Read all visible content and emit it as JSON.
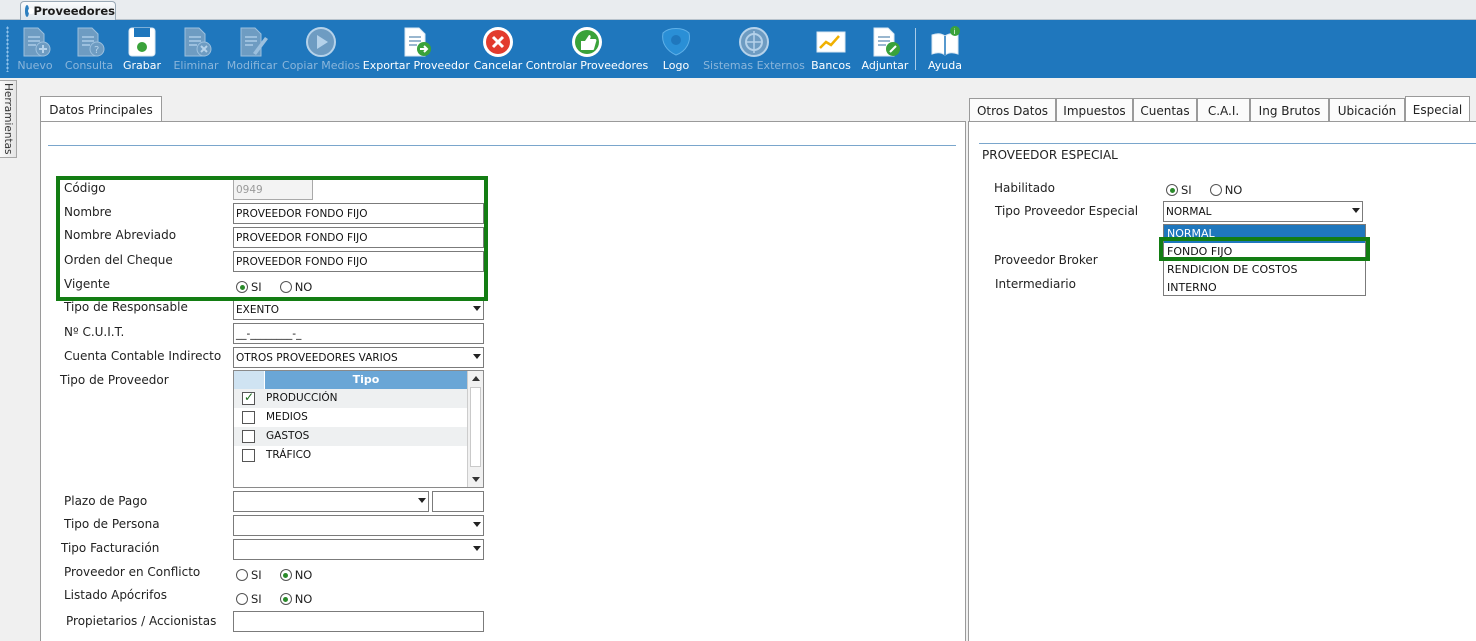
{
  "window": {
    "tab_title": "Proveedores"
  },
  "toolbar": {
    "buttons": [
      {
        "label": "Nuevo",
        "icon": "new-document-icon",
        "enabled": false
      },
      {
        "label": "Consulta",
        "icon": "query-document-icon",
        "enabled": false
      },
      {
        "label": "Grabar",
        "icon": "save-disk-icon",
        "enabled": true
      },
      {
        "label": "Eliminar",
        "icon": "delete-document-icon",
        "enabled": false
      },
      {
        "label": "Modificar",
        "icon": "edit-document-icon",
        "enabled": false
      },
      {
        "label": "Copiar Medios",
        "icon": "play-circle-icon",
        "enabled": false
      },
      {
        "label": "Exportar Proveedor",
        "icon": "export-document-icon",
        "enabled": true
      },
      {
        "label": "Cancelar",
        "icon": "cancel-icon",
        "enabled": true
      },
      {
        "label": "Controlar Proveedores",
        "icon": "thumbs-up-icon",
        "enabled": true
      },
      {
        "label": "Logo",
        "icon": "logo-icon",
        "enabled": true
      },
      {
        "label": "Sistemas Externos",
        "icon": "external-systems-icon",
        "enabled": false
      },
      {
        "label": "Bancos",
        "icon": "chart-icon",
        "enabled": true
      },
      {
        "label": "Adjuntar",
        "icon": "attach-document-icon",
        "enabled": true
      },
      {
        "label": "Ayuda",
        "icon": "help-book-icon",
        "enabled": true
      }
    ]
  },
  "side_tab": {
    "label": "Herramientas"
  },
  "left_panel": {
    "tab": "Datos Principales",
    "fields": {
      "codigo": {
        "label": "Código",
        "value": "0949"
      },
      "nombre": {
        "label": "Nombre",
        "value": "PROVEEDOR FONDO FIJO"
      },
      "nombre_abreviado": {
        "label": "Nombre Abreviado",
        "value": "PROVEEDOR FONDO FIJO"
      },
      "orden_cheque": {
        "label": "Orden del Cheque",
        "value": "PROVEEDOR FONDO FIJO"
      },
      "vigente": {
        "label": "Vigente",
        "yes": "SI",
        "no": "NO",
        "selected": "SI"
      },
      "tipo_responsable": {
        "label": "Tipo de Responsable",
        "value": "EXENTO"
      },
      "cuit": {
        "label": "Nº C.U.I.T.",
        "value": "__-________-_"
      },
      "cuenta_contable": {
        "label": "Cuenta Contable Indirecto",
        "value": "OTROS PROVEEDORES VARIOS"
      },
      "tipo_proveedor": {
        "label": "Tipo de Proveedor",
        "column": "Tipo",
        "rows": [
          {
            "name": "PRODUCCIÓN",
            "checked": true
          },
          {
            "name": "MEDIOS",
            "checked": false
          },
          {
            "name": "GASTOS",
            "checked": false
          },
          {
            "name": "TRÁFICO",
            "checked": false
          }
        ]
      },
      "plazo_pago": {
        "label": "Plazo de Pago",
        "value": "",
        "extra": ""
      },
      "tipo_persona": {
        "label": "Tipo de Persona",
        "value": ""
      },
      "tipo_facturacion": {
        "label": "Tipo Facturación",
        "value": ""
      },
      "proveedor_conflicto": {
        "label": "Proveedor en Conflicto",
        "yes": "SI",
        "no": "NO",
        "selected": "NO"
      },
      "listado_apocrifos": {
        "label": "Listado Apócrifos",
        "yes": "SI",
        "no": "NO",
        "selected": "NO"
      },
      "propietarios": {
        "label": "Propietarios / Accionistas",
        "value": ""
      }
    }
  },
  "right_panel": {
    "tabs": [
      "Otros Datos",
      "Impuestos",
      "Cuentas",
      "C.A.I.",
      "Ing Brutos",
      "Ubicación",
      "Especial"
    ],
    "active_tab": "Especial",
    "section_title": "PROVEEDOR ESPECIAL",
    "habilitado": {
      "label": "Habilitado",
      "yes": "SI",
      "no": "NO",
      "selected": "SI"
    },
    "tipo_especial": {
      "label": "Tipo Proveedor Especial",
      "value": "NORMAL",
      "options": [
        "NORMAL",
        "FONDO FIJO",
        "RENDICION DE COSTOS",
        "INTERNO"
      ],
      "highlighted": "NORMAL"
    },
    "proveedor_broker": {
      "label": "Proveedor Broker"
    },
    "intermediario": {
      "label": "Intermediario"
    }
  },
  "colors": {
    "toolbar": "#1f77bd",
    "highlight_box": "#137d13",
    "accent": "#6aa6d6"
  }
}
